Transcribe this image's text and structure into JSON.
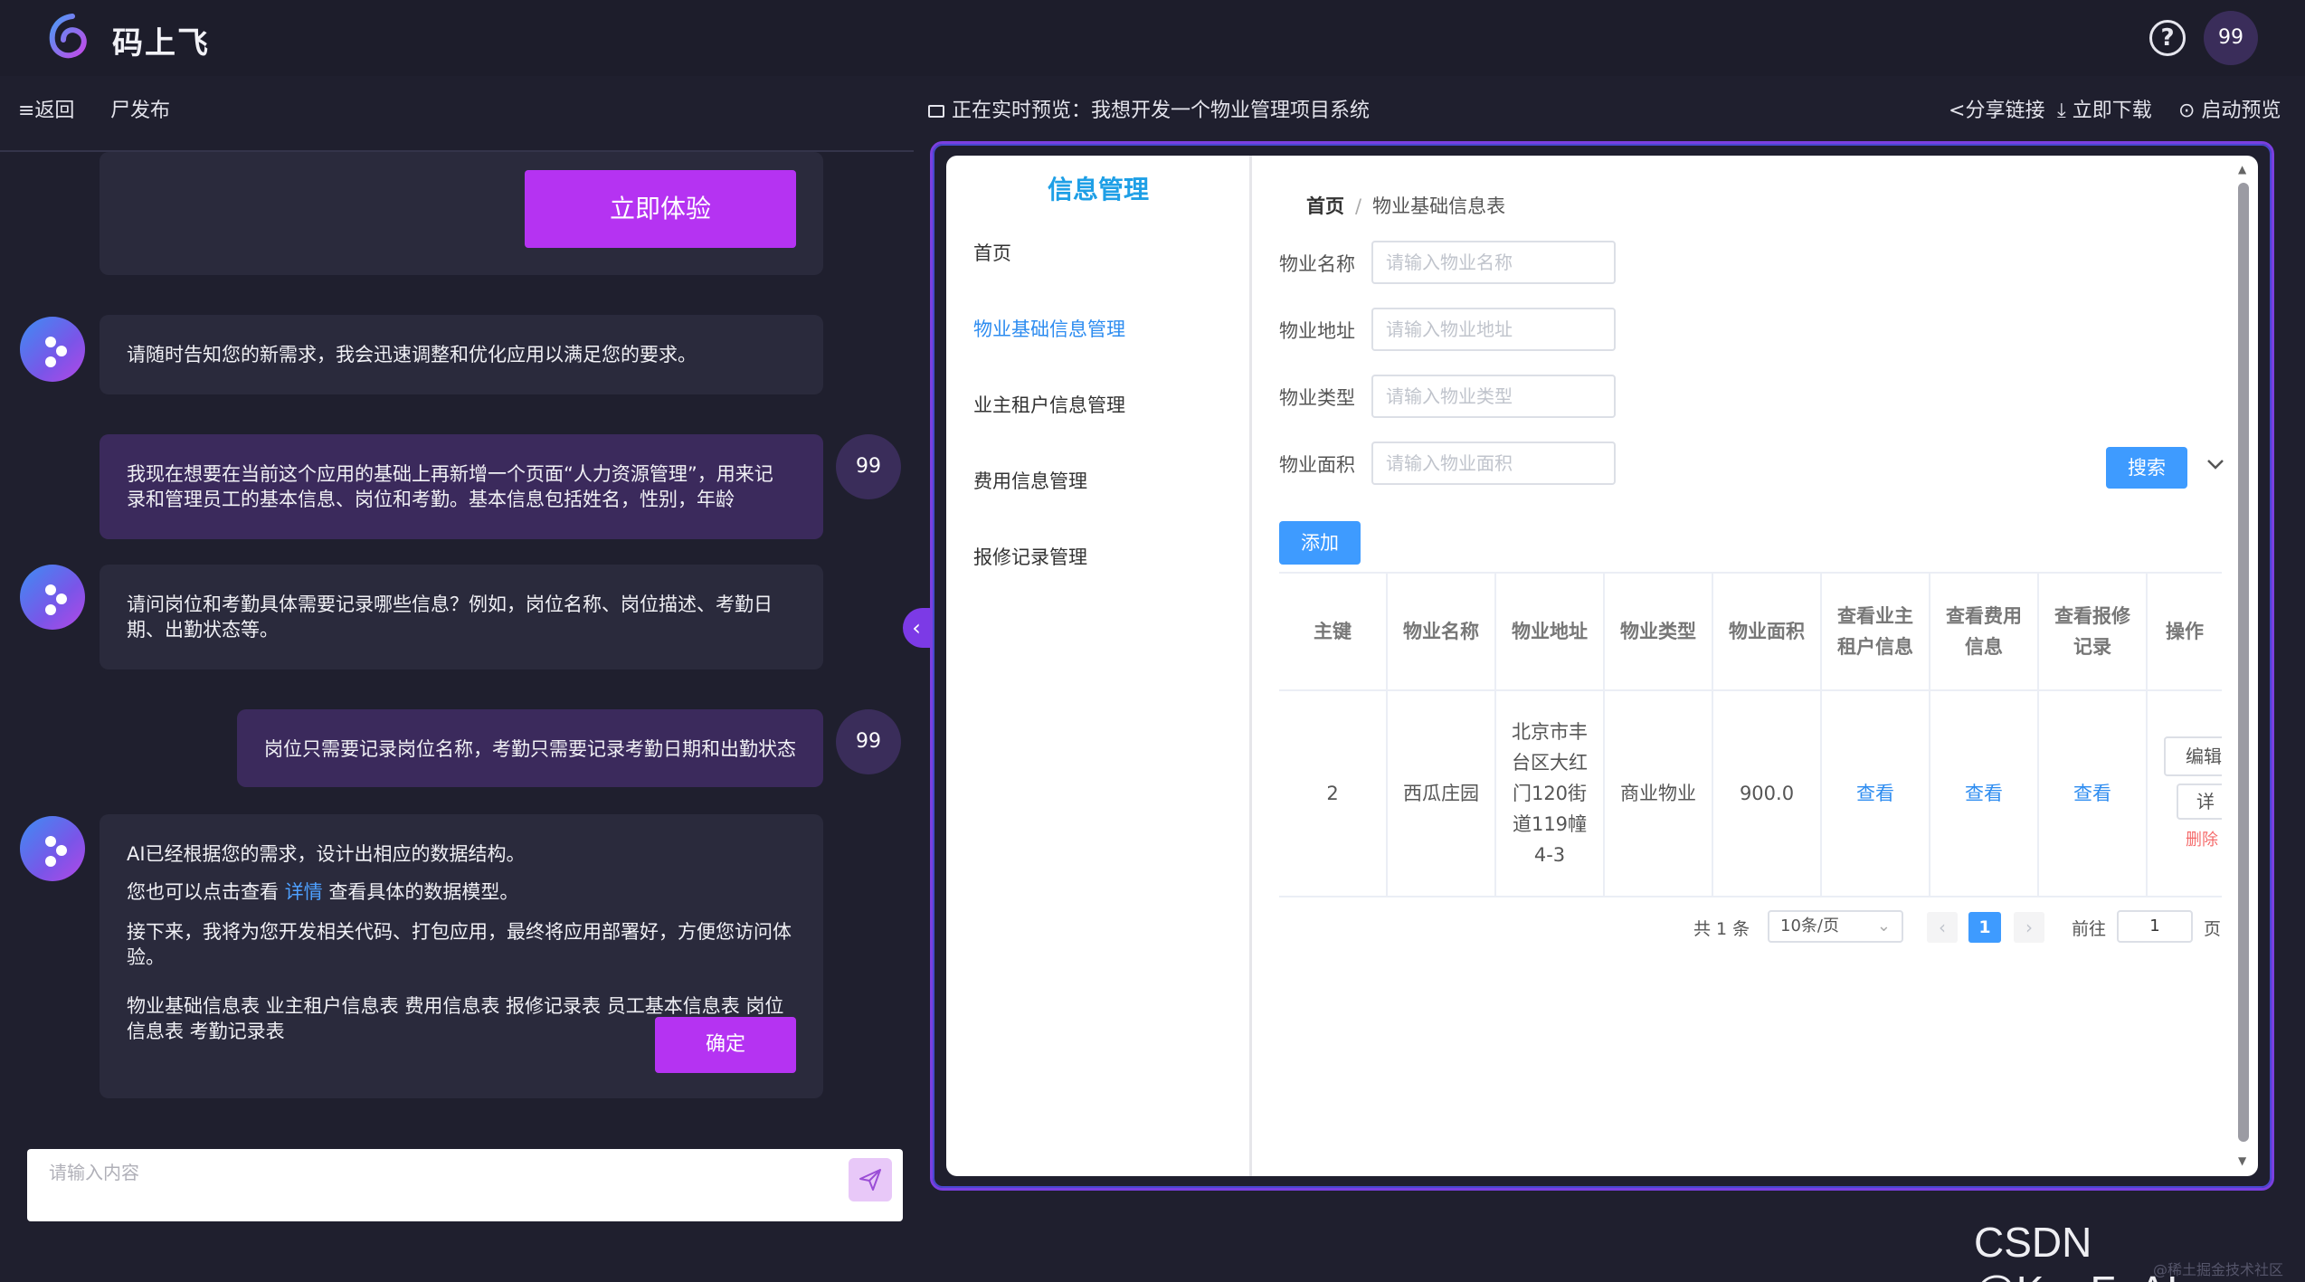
{
  "app": {
    "title": "码上飞",
    "user_avatar": "99"
  },
  "subbar": {
    "back": "≡返回",
    "publish": "尸发布",
    "preview_title": "正在实时预览：我想开发一个物业管理项目系统",
    "share": "分享链接",
    "download": "立即下载",
    "launch": "启动预览"
  },
  "chat": {
    "try_button": "立即体验",
    "messages": [
      {
        "role": "bot",
        "text": "请随时告知您的新需求，我会迅速调整和优化应用以满足您的要求。"
      },
      {
        "role": "user",
        "avatar": "99",
        "line1": "我现在想要在当前这个应用的基础上再新增一个页面“人力资源管理”，用来记",
        "line2": "录和管理员工的基本信息、岗位和考勤。基本信息包括姓名，性别，年龄"
      },
      {
        "role": "bot",
        "line1": "请问岗位和考勤具体需要记录哪些信息？例如，岗位名称、岗位描述、考勤日",
        "line2": "期、出勤状态等。"
      },
      {
        "role": "user",
        "avatar": "99",
        "text": "岗位只需要记录岗位名称，考勤只需要记录考勤日期和出勤状态"
      },
      {
        "role": "bot",
        "p1": "AI已经根据您的需求，设计出相应的数据结构。",
        "p2_a": "您也可以点击查看 ",
        "p2_link": "详情",
        "p2_b": " 查看具体的数据模型。",
        "p3_l1": "接下来，我将为您开发相关代码、打包应用，最终将应用部署好，方便您访问体",
        "p3_l2": "验。",
        "p4_l1": "物业基础信息表 业主租户信息表 费用信息表 报修记录表 员工基本信息表 岗位",
        "p4_l2": "信息表 考勤记录表"
      }
    ],
    "confirm_button": "确定",
    "input_placeholder": "请输入内容"
  },
  "preview": {
    "sidebar": {
      "title": "信息管理",
      "items": [
        "首页",
        "物业基础信息管理",
        "业主租户信息管理",
        "费用信息管理",
        "报修记录管理"
      ],
      "active_index": 1
    },
    "breadcrumb": {
      "home": "首页",
      "separator": "/",
      "current": "物业基础信息表"
    },
    "filters": [
      {
        "label": "物业名称",
        "placeholder": "请输入物业名称"
      },
      {
        "label": "物业地址",
        "placeholder": "请输入物业地址"
      },
      {
        "label": "物业类型",
        "placeholder": "请输入物业类型"
      },
      {
        "label": "物业面积",
        "placeholder": "请输入物业面积"
      }
    ],
    "search_button": "搜索",
    "add_button": "添加",
    "table": {
      "headers": [
        "主键",
        "物业名称",
        "物业地址",
        "物业类型",
        "物业面积",
        "查看业主租户信息",
        "查看费用信息",
        "查看报修记录",
        "操作"
      ],
      "row": {
        "id": "2",
        "name": "西瓜庄园",
        "address": "北京市丰台区大红门120街道119幢4-3",
        "type": "商业物业",
        "area": "900.0",
        "view_owner": "查看",
        "view_fee": "查看",
        "view_repair": "查看",
        "op_edit": "编辑",
        "op_detail": "详",
        "op_delete": "删除"
      }
    },
    "pagination": {
      "total": "共 1 条",
      "page_size": "10条/页",
      "current": "1",
      "goto": "前往",
      "goto_value": "1",
      "page_suffix": "页"
    }
  },
  "watermark": {
    "main": "CSDN @KuaFuAI",
    "small": "@稀土掘金技术社区"
  },
  "colors": {
    "accent_purple": "#b533f2",
    "primary_blue": "#3e9bff",
    "background": "#1f1f2e"
  },
  "icons": [
    "logo-icon",
    "help-icon",
    "send-icon",
    "share-icon",
    "download-icon",
    "play-icon",
    "chevron-down-icon",
    "chevron-left-icon"
  ]
}
